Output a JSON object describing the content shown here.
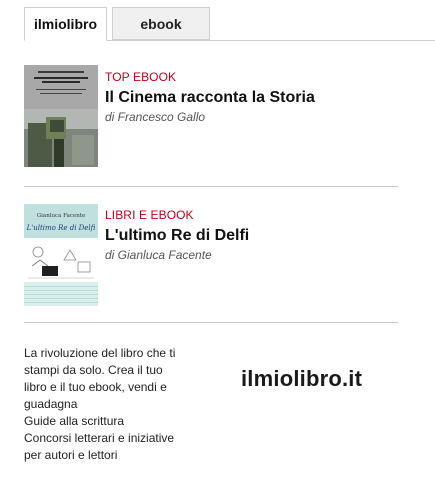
{
  "tabs": [
    {
      "label": "ilmiolibro"
    },
    {
      "label": "ebook"
    }
  ],
  "books": [
    {
      "category": "TOP EBOOK",
      "title": "Il Cinema racconta la Storia",
      "author": "di Francesco Gallo"
    },
    {
      "category": "LIBRI E EBOOK",
      "title": "L'ultimo Re di Delfi",
      "author": "di Gianluca Facente",
      "cover_author": "Gianluca Facente",
      "cover_title": "L'ultimo Re di Delfi"
    }
  ],
  "promo": {
    "lines": [
      "La rivoluzione del libro che ti",
      "stampi da solo. Crea il tuo",
      "libro e il tuo ebook, vendi e",
      "guadagna",
      "Guide alla scrittura",
      "Concorsi letterari e iniziative",
      "per autori e lettori"
    ],
    "logo_text": "ilmiolibro.it"
  },
  "colors": {
    "category_red": "#c0001a",
    "tab_border": "#cfcfcf",
    "inactive_tab_bg": "#f0f0f0"
  }
}
